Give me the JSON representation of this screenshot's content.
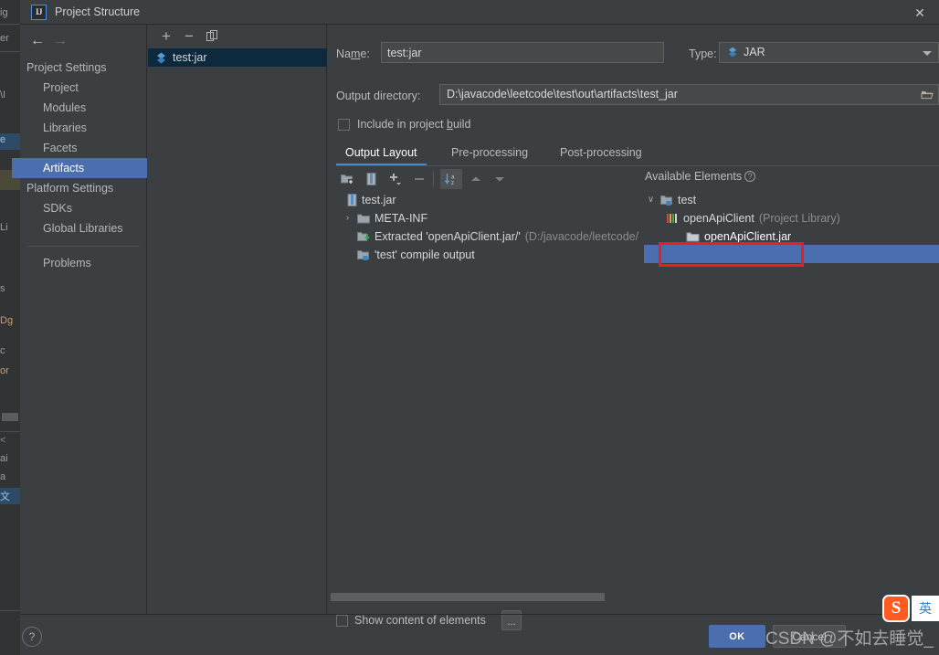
{
  "window": {
    "title": "Project Structure",
    "app_icon_text": "IJ",
    "close_label": "✕"
  },
  "nav": {
    "back_label": "←",
    "forward_label": "→",
    "sections": [
      {
        "label": "Project Settings",
        "type": "header"
      },
      {
        "label": "Project",
        "type": "child"
      },
      {
        "label": "Modules",
        "type": "child"
      },
      {
        "label": "Libraries",
        "type": "child"
      },
      {
        "label": "Facets",
        "type": "child"
      },
      {
        "label": "Artifacts",
        "type": "child",
        "selected": true
      },
      {
        "label": "Platform Settings",
        "type": "header"
      },
      {
        "label": "SDKs",
        "type": "child"
      },
      {
        "label": "Global Libraries",
        "type": "child"
      },
      {
        "label": "Problems",
        "type": "child",
        "after_separator": true
      }
    ]
  },
  "artifacts_panel": {
    "toolbar": {
      "add_label": "+",
      "remove_label": "−",
      "copy_label": "copy-icon"
    },
    "items": [
      {
        "label": "test:jar",
        "icon": "artifact-icon",
        "selected": true
      }
    ]
  },
  "form": {
    "name_label": "Name:",
    "name_label_pre": "Na",
    "name_label_mnemonic": "m",
    "name_label_post": "e:",
    "name_value": "test:jar",
    "type_label": "Type:",
    "type_value": "JAR",
    "output_dir_label": "Output directory:",
    "output_dir_value": "D:\\javacode\\leetcode\\test\\out\\artifacts\\test_jar",
    "include_label_pre": "Include in project ",
    "include_label_mnemonic": "b",
    "include_label_post": "uild",
    "include_checked": false
  },
  "tabs": [
    {
      "label": "Output Layout",
      "active": true
    },
    {
      "label": "Pre-processing",
      "active": false
    },
    {
      "label": "Post-processing",
      "active": false
    }
  ],
  "layout_toolbar": {
    "buttons": [
      "add-directory-icon",
      "add-archive-icon",
      "add-copy-icon",
      "remove-icon",
      "sort-az-icon",
      "move-up-icon",
      "move-down-icon"
    ]
  },
  "output_tree": {
    "rows": [
      {
        "label": "test.jar",
        "icon": "jar-icon",
        "indent": 0,
        "twisty": ""
      },
      {
        "label": "META-INF",
        "icon": "folder-icon",
        "indent": 1,
        "twisty": "›"
      },
      {
        "label": "Extracted 'openApiClient.jar/'",
        "suffix": "(D:/javacode/leetcode/",
        "icon": "extracted-icon",
        "indent": 1,
        "twisty": ""
      },
      {
        "label": "'test' compile output",
        "icon": "compile-output-icon",
        "indent": 1,
        "twisty": ""
      }
    ]
  },
  "available_elements": {
    "title": "Available Elements",
    "help_label": "?",
    "rows": [
      {
        "label": "test",
        "icon": "module-folder-icon",
        "indent": 0,
        "twisty": "∨",
        "dim": false
      },
      {
        "label": "openApiClient",
        "suffix": "(Project Library)",
        "icon": "library-icon",
        "indent": 1,
        "twisty": "",
        "dim": false
      },
      {
        "label": "openApiClient.jar",
        "icon": "folder-icon",
        "indent": 2,
        "twisty": "",
        "selected": true,
        "highlighted": true
      }
    ]
  },
  "bottom": {
    "show_content_label": "Show content of elements",
    "show_content_checked": false,
    "dots_label": "...",
    "help_label": "?",
    "ok_label": "OK",
    "cancel_label": "Cancel"
  },
  "watermark": {
    "text": "CSDN @不如去睡觉_"
  },
  "ime": {
    "logo_label": "S",
    "mode_label": "英"
  },
  "background_window": {
    "fragments": [
      "ig",
      "er",
      "\\I",
      "e",
      "Li",
      "s",
      "Dg",
      "c",
      "or",
      "ai",
      "a",
      "文"
    ]
  },
  "colors": {
    "accent": "#4b6eaf",
    "dialog_bg": "#3c3f41",
    "field_bg": "#45494a",
    "highlight_red": "#f01c1c",
    "tab_underline": "#4a88c7"
  }
}
